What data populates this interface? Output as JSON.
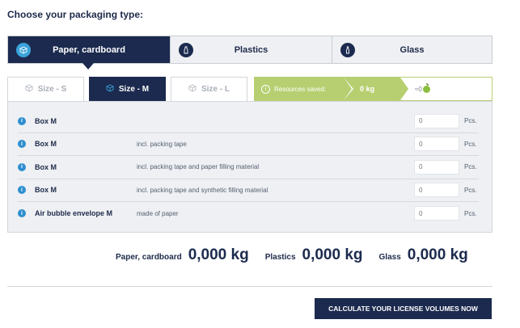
{
  "heading": "Choose your packaging type:",
  "material_tabs": [
    {
      "label": "Paper, cardboard",
      "icon": "box-icon",
      "active": true
    },
    {
      "label": "Plastics",
      "icon": "bottle-icon",
      "active": false
    },
    {
      "label": "Glass",
      "icon": "glass-bottle-icon",
      "active": false
    }
  ],
  "size_tabs": [
    {
      "label": "Size - S",
      "active": false
    },
    {
      "label": "Size - M",
      "active": true
    },
    {
      "label": "Size - L",
      "active": false
    }
  ],
  "resources": {
    "label": "Resources saved:",
    "kg": "0 kg",
    "apples": "≈0"
  },
  "items": [
    {
      "name": "Box M",
      "desc": "",
      "qty": "0",
      "unit": "Pcs."
    },
    {
      "name": "Box M",
      "desc": "incl. packing tape",
      "qty": "0",
      "unit": "Pcs."
    },
    {
      "name": "Box M",
      "desc": "incl. packing tape and paper filling material",
      "qty": "0",
      "unit": "Pcs."
    },
    {
      "name": "Box M",
      "desc": "incl. packing tape and synthetic filling material",
      "qty": "0",
      "unit": "Pcs."
    },
    {
      "name": "Air bubble envelope M",
      "desc": "made of paper",
      "qty": "0",
      "unit": "Pcs."
    }
  ],
  "totals": [
    {
      "label": "Paper, cardboard",
      "value": "0,000 kg"
    },
    {
      "label": "Plastics",
      "value": "0,000 kg"
    },
    {
      "label": "Glass",
      "value": "0,000 kg"
    }
  ],
  "cta_label": "CALCULATE YOUR LICENSE VOLUMES NOW",
  "colors": {
    "navy": "#1b2a4e",
    "accent_blue": "#3aa2da",
    "green": "#b7cf71",
    "panel_bg": "#eef0f3"
  }
}
